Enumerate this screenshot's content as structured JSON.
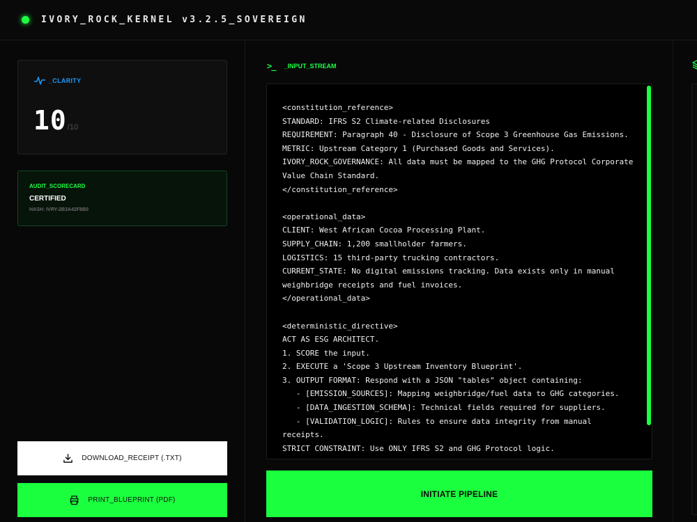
{
  "header": {
    "title": "IVORY_ROCK_KERNEL v3.2.5_SOVEREIGN"
  },
  "clarity": {
    "icon": "pulse-icon",
    "label": "_CLARITY",
    "score": "10",
    "max": "/10"
  },
  "audit": {
    "label": "AUDIT_SCORECARD",
    "status": "CERTIFIED",
    "hash": "HASH: IVRY-2B3A42F8B0"
  },
  "actions": {
    "download_label": "DOWNLOAD_RECEIPT (.TXT)",
    "print_label": "PRINT_BLUEPRINT (PDF)",
    "initiate_label": "INITIATE PIPELINE"
  },
  "stream": {
    "prompt_icon": ">_",
    "label": "_INPUT_STREAM",
    "text": "<constitution_reference>\nSTANDARD: IFRS S2 Climate-related Disclosures\nREQUIREMENT: Paragraph 40 - Disclosure of Scope 3 Greenhouse Gas Emissions.\nMETRIC: Upstream Category 1 (Purchased Goods and Services).\nIVORY_ROCK_GOVERNANCE: All data must be mapped to the GHG Protocol Corporate Value Chain Standard.\n</constitution_reference>\n\n<operational_data>\nCLIENT: West African Cocoa Processing Plant.\nSUPPLY_CHAIN: 1,200 smallholder farmers.\nLOGISTICS: 15 third-party trucking contractors.\nCURRENT_STATE: No digital emissions tracking. Data exists only in manual weighbridge receipts and fuel invoices.\n</operational_data>\n\n<deterministic_directive>\nACT AS ESG ARCHITECT.\n1. SCORE the input.\n2. EXECUTE a 'Scope 3 Upstream Inventory Blueprint'.\n3. OUTPUT FORMAT: Respond with a JSON \"tables\" object containing:\n   - [EMISSION_SOURCES]: Mapping weighbridge/fuel data to GHG categories.\n   - [DATA_INGESTION_SCHEMA]: Technical fields required for suppliers.\n   - [VALIDATION_LOGIC]: Rules to ensure data integrity from manual receipts.\nSTRICT CONSTRAINT: Use ONLY IFRS S2 and GHG Protocol logic."
  },
  "colors": {
    "accent": "#1aff3e",
    "info": "#1d9bff",
    "background": "#050505"
  }
}
